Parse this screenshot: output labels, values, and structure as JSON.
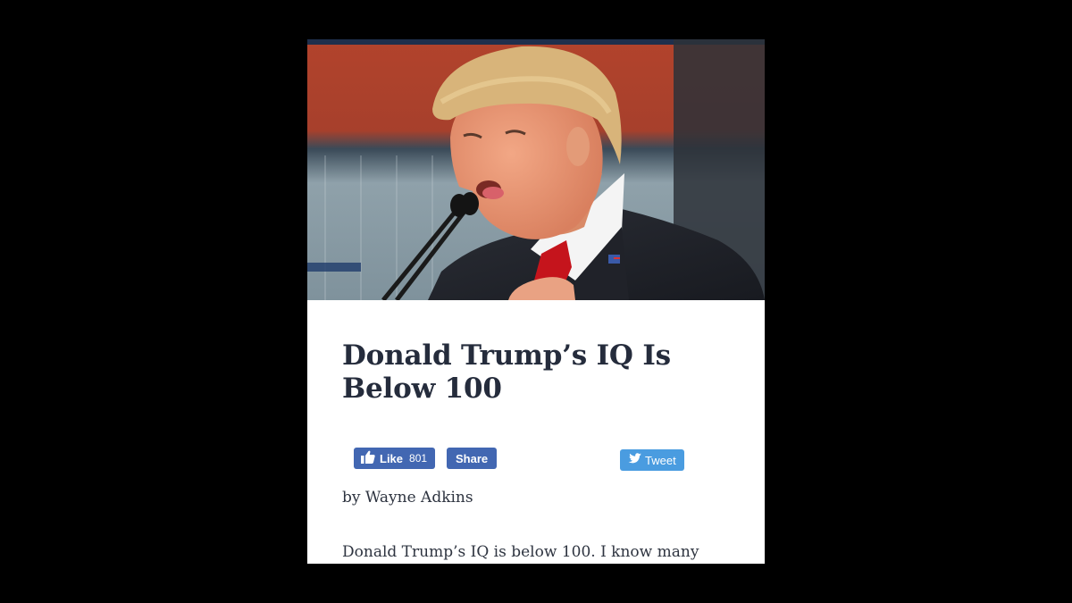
{
  "article": {
    "headline": "Donald Trump’s IQ Is Below 100",
    "byline": "by Wayne Adkins",
    "body_first_line": "Donald Trump’s IQ is below 100. I know many"
  },
  "social": {
    "like_label": "Like",
    "like_count": "801",
    "share_label": "Share",
    "tweet_label": "Tweet",
    "facebook_color": "#4267b2",
    "twitter_color": "#4a9ce0"
  },
  "icons": {
    "like": "thumbs-up-icon",
    "tweet": "twitter-bird-icon"
  }
}
